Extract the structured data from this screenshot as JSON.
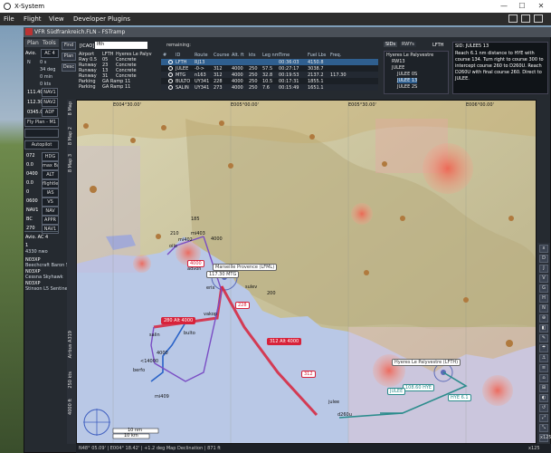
{
  "window": {
    "title": "X-System",
    "minimize": "—",
    "maximize": "☐",
    "close": "✕"
  },
  "menu": {
    "items": [
      "File",
      "Flight",
      "View",
      "Developer",
      "Plugins"
    ]
  },
  "plugin": {
    "title": "VFR Südfrankreich.FLN - FSTramp"
  },
  "left": {
    "tabs": [
      "Plan",
      "Tools"
    ],
    "avio_label": "Avio.",
    "ac_label": "AC 4",
    "values": [
      {
        "text": "N",
        "v": "0 s"
      },
      {
        "text": "",
        "v": "34 deg"
      },
      {
        "text": "",
        "v": "0 min"
      },
      {
        "text": "",
        "v": "0 kts"
      }
    ],
    "nav": [
      {
        "freq": "111.40",
        "name": "NAV1"
      },
      {
        "freq": "112.30",
        "name": "NAV2"
      },
      {
        "freq": "0345.0",
        "name": "ADF"
      }
    ],
    "fly_plan": "Fly Plan - M1",
    "autopilot": "Autopilot",
    "ap_rows": [
      {
        "v": "072",
        "b": "HDG"
      },
      {
        "v": "0.0",
        "b": "max Bank"
      },
      {
        "v": "0400",
        "b": "ALT"
      },
      {
        "v": "0.0",
        "b": "flightlevel"
      },
      {
        "v": "0",
        "b": "IAS"
      },
      {
        "v": "0600",
        "b": "VS"
      },
      {
        "v": "NAV1",
        "b": "NAV"
      },
      {
        "v": "BC",
        "b": "APPR"
      },
      {
        "v": "270",
        "b": "NAV1"
      }
    ],
    "ac_list_title": "Avio.    AC 4",
    "ac_list": [
      {
        "id": "1",
        "desc": "4330 nwo"
      },
      {
        "id": "N03XP",
        "desc": "Beechcraft Baron 5"
      },
      {
        "id": "N03XP",
        "desc": "Cessna Skyhawk"
      },
      {
        "id": "N03XP",
        "desc": "Stinson L5 Sentinel"
      }
    ]
  },
  "find": {
    "buttons": [
      "Find",
      "Plan",
      "Desc"
    ],
    "icao_label": "[ICAO]",
    "icao_value": "lfth",
    "rows": [
      [
        "Airport",
        "LFTH",
        "Hyeres Le Palyv"
      ],
      [
        "Rwy 0.5",
        "05",
        "Concrete"
      ],
      [
        "Runway",
        "23",
        "Concrete"
      ],
      [
        "Runway",
        "13",
        "Concrete"
      ],
      [
        "Runway",
        "31",
        "Concrete"
      ],
      [
        "Parking",
        "GA Ramp 11",
        ""
      ],
      [
        "Parking",
        "GA Ramp 11",
        ""
      ]
    ]
  },
  "plan_table": {
    "remaining_label": "remaining:",
    "headers": [
      "#",
      "ID",
      "Route",
      "Course",
      "Alt. ft",
      "kts",
      "Leg nm",
      "Time",
      "Fuel Lbs",
      "Freq."
    ],
    "rows": [
      [
        "",
        "LFTH",
        "RJ13",
        "",
        "",
        "",
        "",
        "00:36:03",
        "4150.8",
        ""
      ],
      [
        "",
        "JULEE",
        "-0->",
        "312",
        "4000",
        "250",
        "57.5",
        "00:27:17",
        "3038.7",
        ""
      ],
      [
        "",
        "MTG",
        "n163",
        "312",
        "4000",
        "250",
        "32.8",
        "00:19:53",
        "2137.2",
        "117.30"
      ],
      [
        "",
        "BULTO",
        "UY341",
        "228",
        "4000",
        "250",
        "10.5",
        "00:17:31",
        "1855.1",
        ""
      ],
      [
        "",
        "SALIN",
        "UY341",
        "273",
        "4000",
        "250",
        "7.6",
        "00:15:49",
        "1651.1",
        ""
      ]
    ]
  },
  "sid": {
    "tabs": [
      "SIDs",
      "RWYs"
    ],
    "airport_code": "LFTH",
    "tree": [
      "Hyeres Le Palyvestre",
      "RW13",
      "JULEE",
      "JULEE 0S",
      "JULEE 13",
      "JULEE 2S"
    ],
    "title": "SID: JULEE5 13",
    "desc": "Reach 6.1 nm distance to HYE with course 134. Turn right to course 300 to intercept course 260 to D260U. Reach D260U with final course 260. Direct to JULEE."
  },
  "map": {
    "vtabs": [
      "8 Map",
      "8 Map 2",
      "8 Map 3"
    ],
    "bottom_vtabs": [
      "4000 ft",
      "250 kts",
      "Airbus A319"
    ],
    "lat_top": [
      "E004°30.00'",
      "E005°00.00'",
      "E005°30.00'",
      "E006°00.00'"
    ],
    "scale": "10 nm",
    "scale2": "10 km",
    "airports": [
      {
        "name": "Marseille Provence (LFML)",
        "sub": "117.30 MTG"
      },
      {
        "name": "Hyeres Le Palyvestre (LFTH)",
        "sub": "108.60 HYE"
      }
    ],
    "waypoints": [
      "185",
      "210",
      "oilo",
      "mi402",
      "mi403",
      "advon",
      "erix",
      "sulev",
      "4000",
      "200",
      "bulto",
      "vakop",
      "salin",
      "<14000",
      "4000",
      "berfo",
      "mi409",
      "julee",
      "d260u",
      "JULEE",
      "HYE 6.1"
    ],
    "route_labels": [
      "4000",
      "312 Alt 4000",
      "280 Alt 4000",
      "228",
      "312"
    ]
  },
  "right_tools": [
    "x",
    "D",
    "J",
    "V",
    "G",
    "H",
    "N",
    "⊕",
    "◧",
    "✎",
    "☂",
    "⚓",
    "≡",
    "⌂",
    "⊞",
    "◐",
    "↺",
    "⤢",
    "⤡",
    "x125"
  ],
  "status": {
    "pos": "N48° 05.09' | E004° 18.42' | +1.2 deg Map Declination | 871 ft",
    "zoom": "x125"
  },
  "colors": {
    "route_red": "#d7223a",
    "route_purple": "#7a4dc4",
    "route_blue": "#2a63c8",
    "route_teal": "#2b8c8c",
    "sea": "#b9c8e6"
  }
}
